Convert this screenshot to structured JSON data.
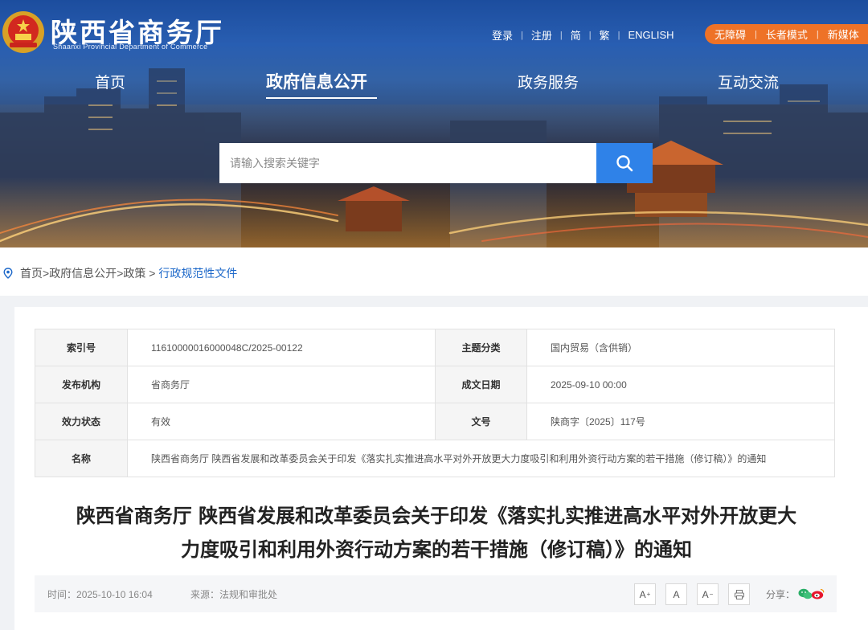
{
  "header": {
    "site_title": "陕西省商务厅",
    "site_subtitle": "Shaanxi Provincial Department of Commerce",
    "top_links": [
      "登录",
      "注册",
      "简",
      "繁",
      "ENGLISH"
    ],
    "pill_links": [
      "无障碍",
      "长者模式",
      "新媒体"
    ]
  },
  "nav": {
    "items": [
      "首页",
      "政府信息公开",
      "政务服务",
      "互动交流"
    ],
    "active": "政府信息公开"
  },
  "search": {
    "placeholder": "请输入搜索关键字",
    "value": ""
  },
  "breadcrumb": {
    "items": [
      "首页",
      "政府信息公开",
      "政策"
    ],
    "current": "行政规范性文件",
    "separator_last": " > "
  },
  "meta": {
    "index_label": "索引号",
    "index_value": "11610000016000048C/2025-00122",
    "topic_label": "主题分类",
    "topic_value": "国内贸易（含供销）",
    "org_label": "发布机构",
    "org_value": "省商务厅",
    "date_label": "成文日期",
    "date_value": "2025-09-10 00:00",
    "status_label": "效力状态",
    "status_value": "有效",
    "docno_label": "文号",
    "docno_value": "陕商字〔2025〕117号",
    "name_label": "名称",
    "name_value": "陕西省商务厅 陕西省发展和改革委员会关于印发《落实扎实推进高水平对外开放更大力度吸引和利用外资行动方案的若干措施（修订稿）》的通知"
  },
  "article": {
    "title_line1": "陕西省商务厅 陕西省发展和改革委员会关于印发《落实扎实推进高水平对外开放更大",
    "title_line2": "力度吸引和利用外资行动方案的若干措施（修订稿）》的通知",
    "time_label": "时间：",
    "time_value": "2025-10-10 16:04",
    "source_label": "来源：",
    "source_value": "法规和审批处",
    "font_buttons": [
      "A",
      "A",
      "A"
    ],
    "font_sup": [
      "+",
      "",
      "−"
    ],
    "share_label": "分享："
  },
  "colors": {
    "accent": "#2f82e8",
    "pill": "#ee7227",
    "link": "#1d68c9"
  },
  "icons": [
    "national-emblem-icon",
    "search-icon",
    "location-pin-icon",
    "print-icon",
    "wechat-icon",
    "weibo-icon"
  ]
}
